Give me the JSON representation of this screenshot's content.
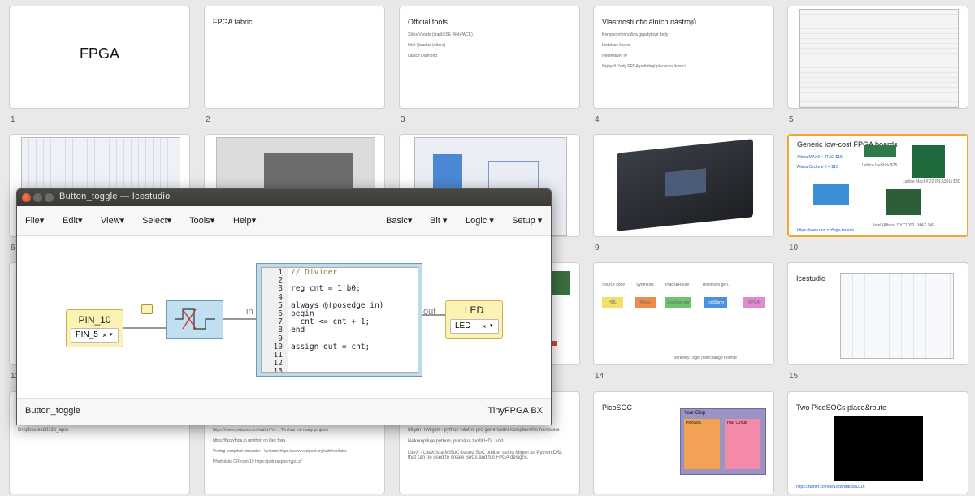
{
  "slides": [
    {
      "n": "1",
      "big": "FPGA"
    },
    {
      "n": "2",
      "title": "FPGA fabric"
    },
    {
      "n": "3",
      "title": "Official tools",
      "lines": [
        "Xilinx Vivado (starší ISE WebPACK)",
        "Intel Quartus (Altera)",
        "Lattice Diamond"
      ]
    },
    {
      "n": "4",
      "title": "Vlastnosti oficiálních nástrojů",
      "lines": [
        "Komplexní množina gigabytové tooly",
        "Instalace licencí",
        "Neefektivní IP",
        "Nejvyšší řady FPGA potřebují placenou licenci"
      ]
    },
    {
      "n": "5"
    },
    {
      "n": "6"
    },
    {
      "n": "9"
    },
    {
      "n": "10",
      "title": "Generic low-cost FPGA boards",
      "lines": [
        "Altera MAX3 + JTAG $15",
        "Altera Cyclone II + $15",
        "Lattice IceStick $25",
        "Lattice MachXO2 (PLA301) $30",
        "Intel (Altera) CYC1000 / MAX $49",
        "https://www.root.cz/fpga-boards"
      ]
    },
    {
      "n": "11"
    },
    {
      "n": "14",
      "lines": [
        "Source code",
        "Synthesis",
        "Place&Route",
        "Bitstream gen.",
        "Berkeley Logic Interchange Format"
      ],
      "boxes": [
        "HDL",
        "Yosys",
        "Arachne-pnr",
        "IceStorm",
        "FPGA"
      ]
    },
    {
      "n": "15",
      "title": "Icestudio"
    },
    {
      "line_a": "Dropbox/es2812b_apio"
    },
    {
      "lines": [
        "https://www.youtube.com/watch?v=... Tim has too many projects",
        "https://fuzzyfpga.io upython on litex fpga",
        "Verilog compiled simulator - Verilator https://www.veripool.org/wiki/verilator",
        "Přednáška OReconf19 https://pub.raspberrypi.cz/"
      ]
    },
    {
      "lines": [
        "Migen, nMigen - python nástroj pro generování komplexního hardware",
        "Nekompiluje python, pomáhá tvořit HDL kód",
        "LiteX - LiteX is a MiSoC-based SoC builder using Migen as Python DSL that can be used to create SoCs and full FPGA designs."
      ]
    },
    {
      "title": "PicoSOC",
      "labels": [
        "Your Chip",
        "PicoSoC",
        "Your Circuit"
      ]
    },
    {
      "title": "Two PicoSOCs place&route",
      "link": "https://twitter.com/oe1cxw/status/1016"
    }
  ],
  "window": {
    "title": "Button_toggle — Icestudio",
    "menu_left": [
      "File",
      "Edit",
      "View",
      "Select",
      "Tools",
      "Help"
    ],
    "menu_right": [
      "Basic",
      "Bit",
      "Logic",
      "Setup"
    ],
    "status_left": "Button_toggle",
    "status_right": "TinyFPGA BX"
  },
  "blocks": {
    "input": {
      "label": "PIN_10",
      "select": "PIN_5"
    },
    "output": {
      "label": "LED",
      "select": "LED"
    },
    "port_in": "in",
    "port_out": "out",
    "code_lines": [
      {
        "n": "1",
        "t": "// Divider"
      },
      {
        "n": "2",
        "t": ""
      },
      {
        "n": "3",
        "t": "reg cnt = 1'b0;"
      },
      {
        "n": "4",
        "t": ""
      },
      {
        "n": "5",
        "t": "always @(posedge in)"
      },
      {
        "n": "6",
        "t": "begin"
      },
      {
        "n": "7",
        "t": "  cnt <= cnt + 1;"
      },
      {
        "n": "8",
        "t": "end"
      },
      {
        "n": "9",
        "t": ""
      },
      {
        "n": "10",
        "t": "assign out = cnt;"
      },
      {
        "n": "11",
        "t": ""
      },
      {
        "n": "12",
        "t": ""
      },
      {
        "n": "13",
        "t": ""
      }
    ]
  }
}
